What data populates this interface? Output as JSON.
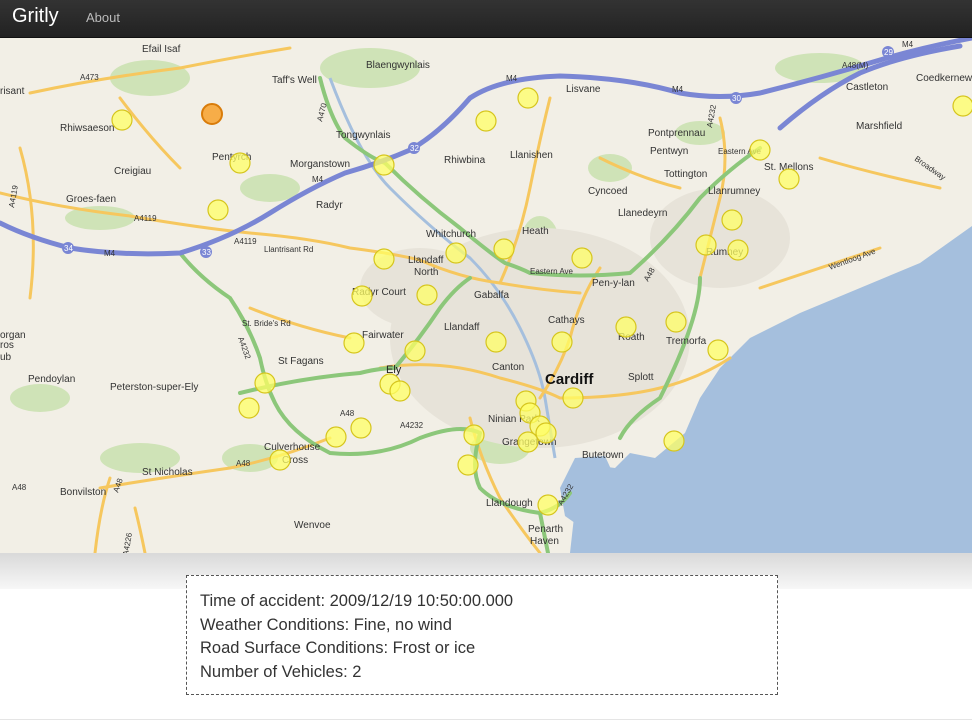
{
  "navbar": {
    "brand": "Gritly",
    "links": [
      {
        "label": "About"
      }
    ]
  },
  "map": {
    "water_color": "#a5bfdd",
    "land_color": "#f2efe6",
    "motorway_color": "#7a86d4",
    "primary_road_color": "#8cc77a",
    "secondary_road_color": "#f6c75e",
    "marker_color": "#ffff66",
    "selected_marker_color": "#f7a536",
    "labels": {
      "cardiff": "Cardiff",
      "efail_isaf": "Efail Isaf",
      "taffs_well": "Taff's Well",
      "blaengwynlais": "Blaengwynlais",
      "lisvane": "Lisvane",
      "coedkernew": "Coedkernew",
      "castleton": "Castleton",
      "marshfield": "Marshfield",
      "rhiwsaeson": "Rhiwsaeson",
      "tongwynlais": "Tongwynlais",
      "pontprennau": "Pontprennau",
      "pentwyn": "Pentwyn",
      "st_mellons": "St. Mellons",
      "creigiau": "Creigiau",
      "pentyrch": "Pentyrch",
      "morganstown": "Morganstown",
      "rhiwbina": "Rhiwbina",
      "llanishen": "Llanishen",
      "tottington": "Tottington",
      "llanrumney": "Llanrumney",
      "cyncoed": "Cyncoed",
      "groes_faen": "Groes-faen",
      "radyr": "Radyr",
      "llanedeyrn": "Llanedeyrn",
      "whitchurch": "Whitchurch",
      "heath": "Heath",
      "llandaff_north_1": "Llandaff",
      "llandaff_north_2": "North",
      "rumney": "Rumney",
      "pen_y_lan": "Pen-y-lan",
      "gabalfa": "Gabalfa",
      "radyr_court": "Radyr Court",
      "cathays": "Cathays",
      "roath": "Roath",
      "tremorfa": "Tremorfa",
      "fairwater": "Fairwater",
      "llandaff": "Llandaff",
      "canton": "Canton",
      "pendoylan": "Pendoylan",
      "st_fagans": "St Fagans",
      "ely": "Ely",
      "splott": "Splott",
      "peterston": "Peterston-super-Ely",
      "ninian_park": "Ninian Park",
      "culverhouse_1": "Culverhouse",
      "culverhouse_2": "Cross",
      "grangetown": "Grangetown",
      "butetown": "Butetown",
      "st_nicholas": "St Nicholas",
      "bonvilston": "Bonvilston",
      "llandough": "Llandough",
      "wenvoe": "Wenvoe",
      "penarth": "Penarth",
      "haven": "Haven",
      "trisant": "risant",
      "organ": "organ",
      "ros": "ros",
      "ub": "ub",
      "m4_a": "M4",
      "m4_b": "M4",
      "m4_c": "M4",
      "m4_d": "M4",
      "m4_e": "M4",
      "a48m": "A48(M)",
      "a473": "A473",
      "a470": "A470",
      "a4119_a": "A4119",
      "a4119_b": "A4119",
      "a4119_c": "A4119",
      "llantrisant_rd": "Llantrisant Rd",
      "st_brides_rd": "St. Bride's Rd",
      "a4232_a": "A4232",
      "a4232_b": "A4232",
      "a4232_c": "A4232",
      "a4232_d": "A4232",
      "a48_a": "A48",
      "a48_b": "A48",
      "a48_c": "A48",
      "a48_d": "A48",
      "a48_e": "A48",
      "eastern_ave_a": "Eastern Ave",
      "eastern_ave_b": "Eastern Ave",
      "broadway": "Broadway",
      "wentloog_ave": "Wentloog Ave",
      "a4226": "A4226",
      "j29": "29",
      "j30": "30",
      "j32": "32",
      "j33": "33",
      "j34": "34"
    }
  },
  "accident": {
    "time": "Time of accident: 2009/12/19 10:50:00.000",
    "weather": "Weather Conditions: Fine, no wind",
    "road_surface": "Road Surface Conditions: Frost or ice",
    "vehicles": "Number of Vehicles: 2"
  }
}
